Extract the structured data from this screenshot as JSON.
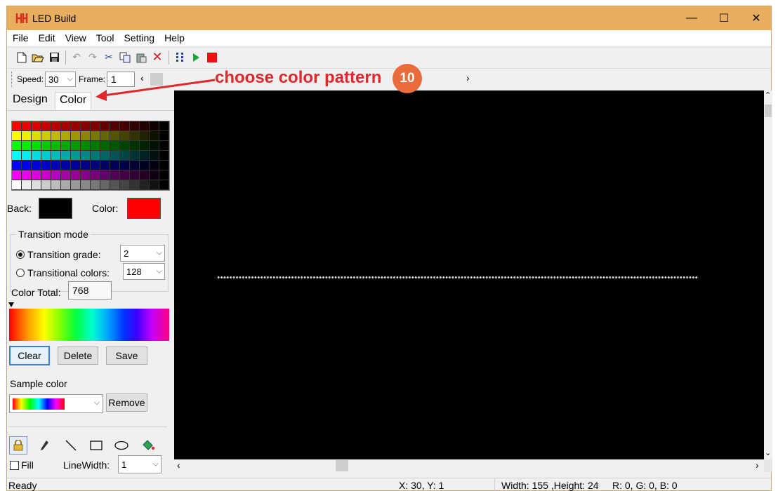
{
  "window": {
    "title": "LED Build",
    "minimize": "—",
    "maximize": "☐",
    "close": "✕"
  },
  "menu": [
    "File",
    "Edit",
    "View",
    "Tool",
    "Setting",
    "Help"
  ],
  "toolbar": {
    "icons": [
      "new-file-icon",
      "open-folder-icon",
      "save-icon",
      "undo-icon",
      "redo-icon",
      "cut-icon",
      "copy-icon",
      "paste-icon",
      "delete-icon",
      "grid-icon",
      "play-icon",
      "stop-icon"
    ]
  },
  "speedbar": {
    "speed_label": "Speed:",
    "speed_value": "30",
    "frame_label": "Frame:",
    "frame_value": "1"
  },
  "annotation": {
    "text": "choose color pattern",
    "number": "10",
    "color": "#e0282c",
    "badge_color": "#ea6b3b"
  },
  "tabs": {
    "design": "Design",
    "color": "Color"
  },
  "palette_rows": [
    [
      "#ff0000",
      "#ee0000",
      "#dd0000",
      "#cc0000",
      "#bb0000",
      "#aa0000",
      "#990000",
      "#880000",
      "#770000",
      "#660000",
      "#550000",
      "#440000",
      "#330000",
      "#220000",
      "#110000",
      "#000000"
    ],
    [
      "#ffff00",
      "#eeee00",
      "#dddd00",
      "#cccc00",
      "#bbbb00",
      "#aaaa00",
      "#999900",
      "#888800",
      "#777700",
      "#666600",
      "#555500",
      "#444400",
      "#333300",
      "#222200",
      "#111100",
      "#000000"
    ],
    [
      "#00ff00",
      "#00ee00",
      "#00dd00",
      "#00cc00",
      "#00bb00",
      "#00aa00",
      "#009900",
      "#008800",
      "#007700",
      "#006600",
      "#005500",
      "#004400",
      "#003300",
      "#002200",
      "#001100",
      "#000000"
    ],
    [
      "#00ffff",
      "#00eeee",
      "#00dddd",
      "#00cccc",
      "#00bbbb",
      "#00aaaa",
      "#009999",
      "#008888",
      "#007777",
      "#006666",
      "#005555",
      "#004444",
      "#003333",
      "#002222",
      "#001111",
      "#000000"
    ],
    [
      "#0000ff",
      "#0000ee",
      "#0000dd",
      "#0000cc",
      "#0000bb",
      "#0000aa",
      "#000099",
      "#000088",
      "#000077",
      "#000066",
      "#000055",
      "#000044",
      "#000033",
      "#000022",
      "#000011",
      "#000000"
    ],
    [
      "#ff00ff",
      "#ee00ee",
      "#dd00dd",
      "#cc00cc",
      "#bb00bb",
      "#aa00aa",
      "#990099",
      "#880088",
      "#770077",
      "#660066",
      "#550055",
      "#440044",
      "#330033",
      "#220022",
      "#110011",
      "#000000"
    ],
    [
      "#ffffff",
      "#eeeeee",
      "#dddddd",
      "#cccccc",
      "#bbbbbb",
      "#aaaaaa",
      "#999999",
      "#888888",
      "#777777",
      "#666666",
      "#555555",
      "#444444",
      "#333333",
      "#222222",
      "#111111",
      "#000000"
    ]
  ],
  "colors": {
    "back_label": "Back:",
    "back_color": "#000000",
    "color_label": "Color:",
    "fore_color": "#ff0000"
  },
  "transition": {
    "legend": "Transition mode",
    "grade_label": "Transition grade:",
    "grade_value": "2",
    "colors_label": "Transitional colors:",
    "colors_value": "128"
  },
  "color_total": {
    "label": "Color Total:",
    "value": "768"
  },
  "buttons": {
    "clear": "Clear",
    "delete": "Delete",
    "save": "Save",
    "remove": "Remove"
  },
  "sample": {
    "label": "Sample color"
  },
  "tools": [
    "lock-icon",
    "pencil-icon",
    "line-icon",
    "rectangle-icon",
    "ellipse-icon",
    "fill-bucket-icon"
  ],
  "fill": {
    "label": "Fill"
  },
  "linewidth": {
    "label": "LineWidth:",
    "value": "1"
  },
  "status": {
    "ready": "Ready",
    "coords": "X: 30, Y: 1",
    "size": "Width: 155 ,Height: 24",
    "rgb": "R:  0, G:  0, B:  0"
  }
}
